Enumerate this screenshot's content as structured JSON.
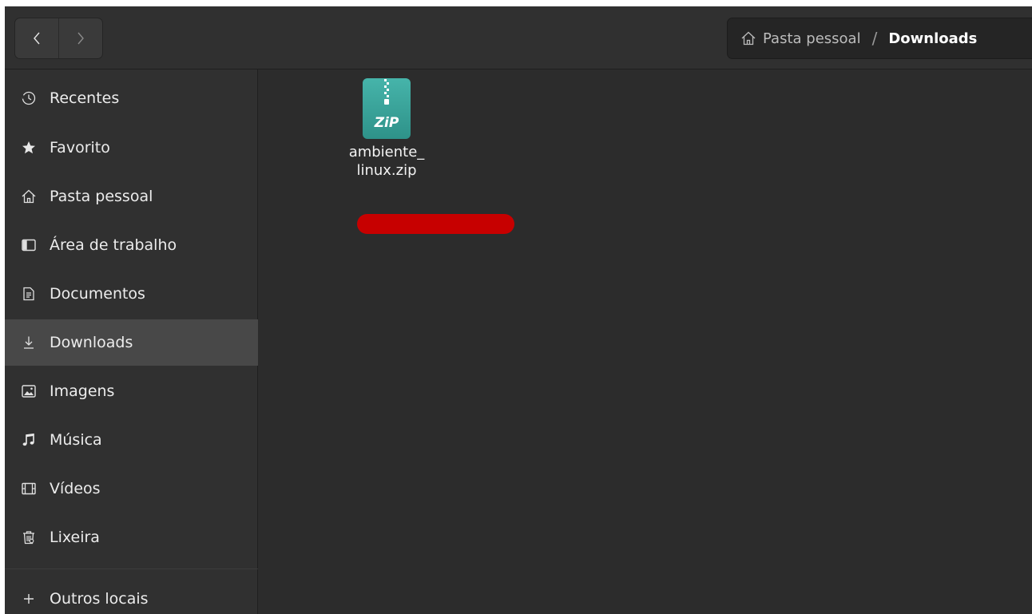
{
  "header": {
    "back_icon": "chevron-left-icon",
    "forward_icon": "chevron-right-icon",
    "path": {
      "home_icon": "home-icon",
      "home_label": "Pasta pessoal",
      "separator": "/",
      "current_label": "Downloads"
    }
  },
  "sidebar": {
    "items": [
      {
        "icon": "clock-icon",
        "label": "Recentes"
      },
      {
        "icon": "star-icon",
        "label": "Favorito"
      },
      {
        "icon": "home-icon",
        "label": "Pasta pessoal"
      },
      {
        "icon": "desktop-icon",
        "label": "Área de trabalho"
      },
      {
        "icon": "document-icon",
        "label": "Documentos"
      },
      {
        "icon": "download-icon",
        "label": "Downloads",
        "selected": true
      },
      {
        "icon": "image-icon",
        "label": "Imagens"
      },
      {
        "icon": "music-icon",
        "label": "Música"
      },
      {
        "icon": "video-icon",
        "label": "Vídeos"
      },
      {
        "icon": "trash-icon",
        "label": "Lixeira"
      }
    ],
    "other_locations": {
      "icon": "plus-icon",
      "label": "Outros locais"
    }
  },
  "files": [
    {
      "name": "ambiente_\nlinux.zip",
      "icon": "zip-archive-icon",
      "icon_label": "ZiP"
    }
  ],
  "colors": {
    "zip_icon": "#3aa39a",
    "redaction": "#c70000",
    "selected_item": "#484848"
  }
}
